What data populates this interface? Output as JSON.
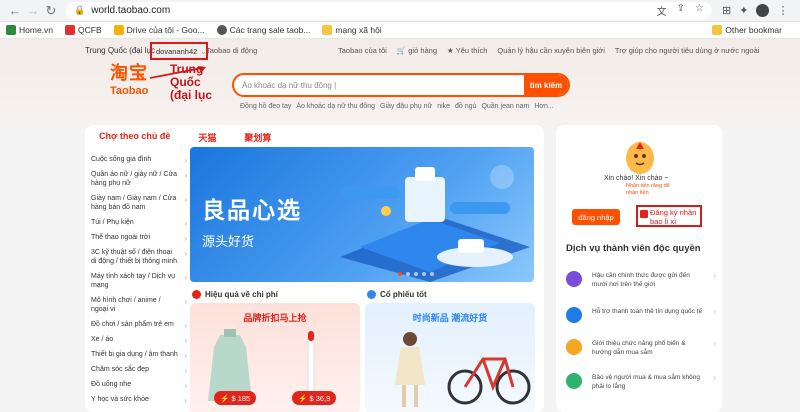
{
  "browser": {
    "url": "world.taobao.com",
    "bookmarks": [
      "Home.vn",
      "QCFB",
      "Drive của tôi - Goo...",
      "Các trang sale taob...",
      "mạng xã hội"
    ],
    "bookmarks_right": "Other bookmar",
    "colors": {
      "accent": "#ff5000"
    }
  },
  "site_nav": {
    "region": "Trung Quốc (đại lục",
    "username": "dovananh42",
    "mobile": "Taobao di động",
    "right": [
      "Taobao của tôi",
      "giỏ hàng",
      "Yêu thích",
      "Quản lý hậu cần xuyên biên giới",
      "Trợ giúp cho người tiêu dùng ở nước ngoài"
    ]
  },
  "brand": {
    "cn": "淘宝",
    "en": "Taobao"
  },
  "annotation": "Trung Quốc (đại lục",
  "search": {
    "placeholder": "Áo khoác dạ nữ thu đông |",
    "button": "tìm kiếm"
  },
  "hotwords": [
    "Đồng hồ đeo tay",
    "Áo khoác dạ nữ thu đông",
    "Giày đậu phụ nữ",
    "nike",
    "đồ ngủ",
    "Quần jean nam",
    "Hơn..."
  ],
  "themes": [
    "Chợ theo chủ đề",
    "天猫",
    "聚划算"
  ],
  "categories": [
    "Cuộc sống gia đình",
    "Quần áo nữ / giày nữ / Cửa hàng phụ nữ",
    "Giày nam / Giày nam / Cửa hàng bán đồ nam",
    "Túi / Phụ kiện",
    "Thể thao ngoài trời",
    "3C kỹ thuật số / điện thoại di động / thiết bị thông minh",
    "Máy tính xách tay / Dịch vụ mạng",
    "Mô hình chơi / anime / ngoại vi",
    "Đồ chơi / sản phẩm trẻ em",
    "Xe / áo",
    "Thiết bị gia dụng / âm thanh",
    "Chăm sóc sắc đẹp",
    "Đồ uống nhẹ",
    "Y học và sức khỏe"
  ],
  "banner": {
    "title": "良品心选",
    "subtitle": "源头好货"
  },
  "sections": [
    {
      "title": "Hiệu quả về chi phí",
      "head": "品牌折扣马上抢",
      "prices": [
        "$ 185",
        "$ 36,9"
      ]
    },
    {
      "title": "Cổ phiếu tốt",
      "head": "时尚新品  潮流好货"
    }
  ],
  "account": {
    "greeting": "Xin chào!  Xin chào ~",
    "hint": "Nhận tiền rảng để nhận tiền",
    "login": "đăng nhập",
    "register": "Đăng ký nhận bao lì xì"
  },
  "services": {
    "title": "Dịch vụ thành viên độc quyền",
    "items": [
      "Hậu cần chính thức được gửi đến mười nơi trên thế giới",
      "Hỗ trợ thanh toán thẻ tín dụng quốc tế",
      "Giới thiệu chức năng phổ biến & hướng dẫn mua sắm",
      "Bảo vệ người mua & mua sắm không phải lo lắng"
    ]
  }
}
